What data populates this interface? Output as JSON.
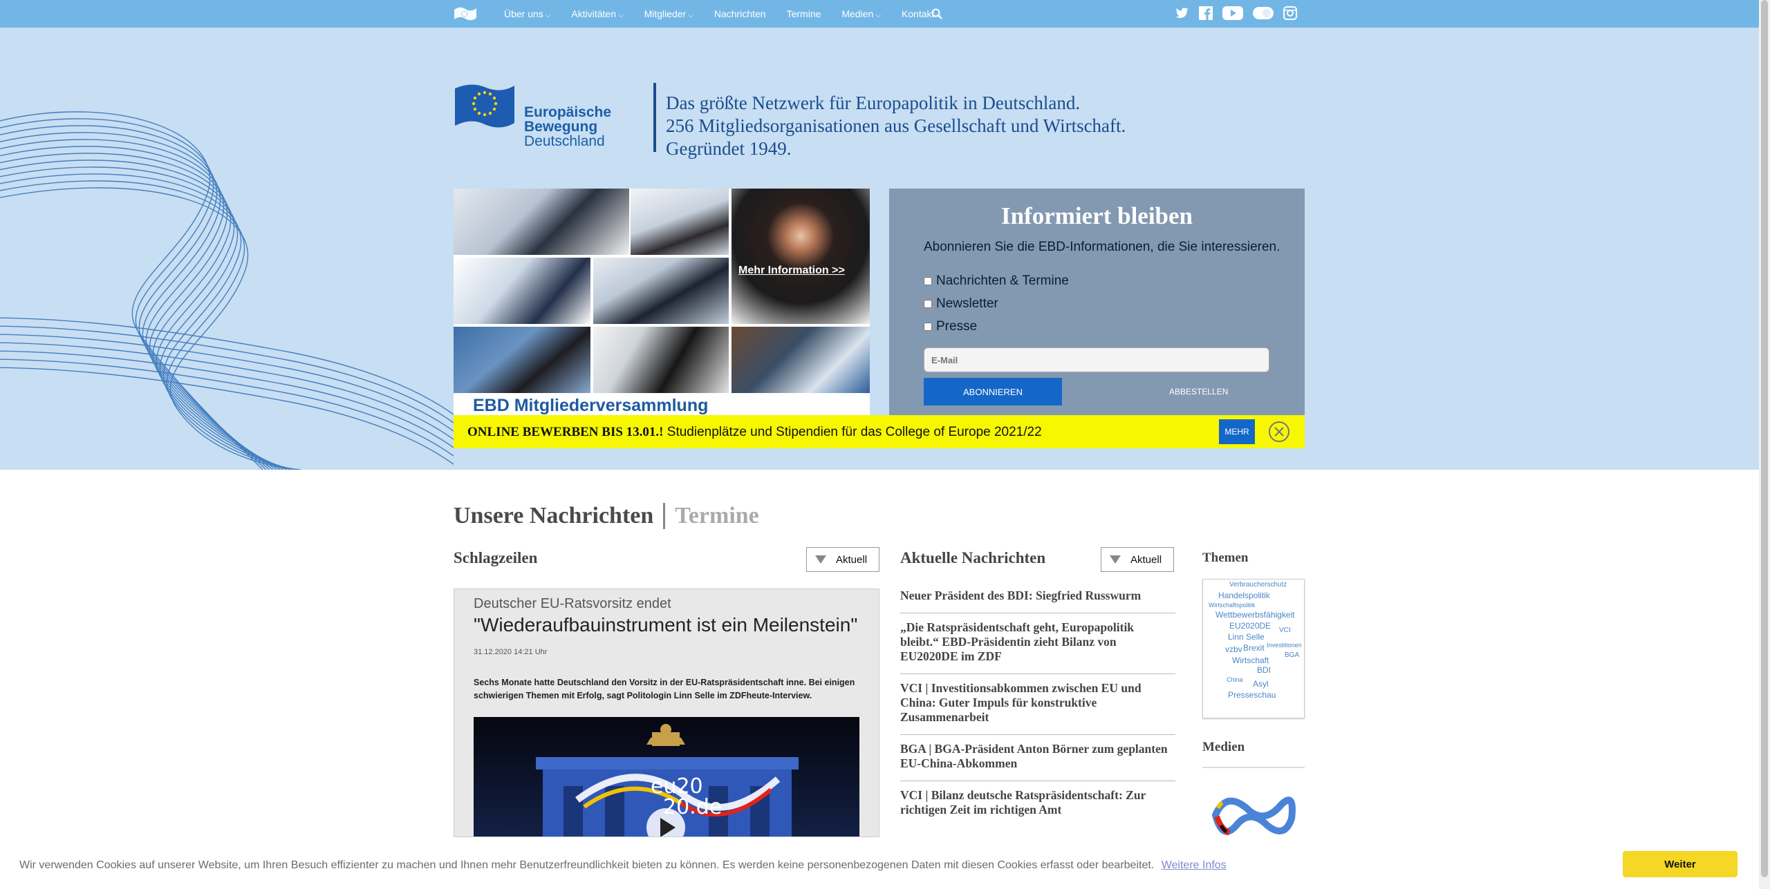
{
  "nav": {
    "items": [
      {
        "label": "Über uns",
        "dropdown": true
      },
      {
        "label": "Aktivitäten",
        "dropdown": true
      },
      {
        "label": "Mitglieder",
        "dropdown": true
      },
      {
        "label": "Nachrichten",
        "dropdown": false
      },
      {
        "label": "Termine",
        "dropdown": false
      },
      {
        "label": "Medien",
        "dropdown": true
      },
      {
        "label": "Kontakt",
        "dropdown": true
      }
    ],
    "social_icons": [
      "twitter-icon",
      "facebook-icon",
      "youtube-icon",
      "flickr-icon",
      "instagram-icon"
    ],
    "bar_color": "#72b6e6"
  },
  "brand": {
    "line1": "Europäische",
    "line2": "Bewegung",
    "line3": "Deutschland",
    "tagline_1": "Das größte Netzwerk für Europapolitik in Deutschland.",
    "tagline_2": "256 Mitgliedsorganisationen aus Gesellschaft und Wirtschaft.",
    "tagline_3": "Gegründet 1949."
  },
  "collage": {
    "caption": "EBD Mitgliederversammlung",
    "more_link": "Mehr Information",
    "more_arrows": ">>"
  },
  "subscribe": {
    "title": "Informiert bleiben",
    "intro": "Abonnieren Sie die EBD-Informationen, die Sie interessieren.",
    "options": [
      "Nachrichten & Termine",
      "Newsletter",
      "Presse"
    ],
    "email_placeholder": "E-Mail",
    "subscribe_button": "ABONNIEREN",
    "unsubscribe_button": "ABBESTELLEN"
  },
  "banner": {
    "bold": "ONLINE BEWERBEN BIS 13.01.!",
    "text": "Studienplätze und Stipendien für das College of Europe 2021/22",
    "button": "MEHR"
  },
  "tabs": {
    "active": "Unsere Nachrichten",
    "inactive": "Termine"
  },
  "headlines": {
    "title": "Schlagzeilen",
    "filter": "Aktuell",
    "article": {
      "kicker": "Deutscher EU-Ratsvorsitz endet",
      "title": "\"Wiederaufbauinstrument ist ein Meilenstein\"",
      "date": "31.12.2020 14:21 Uhr",
      "lead": "Sechs Monate hatte Deutschland den Vorsitz in der EU-Ratspräsidentschaft inne. Bei einigen schwierigen Themen mit Erfolg, sagt Politologin Linn Selle im ZDFheute-Interview.",
      "video_text_1": "eu20",
      "video_text_2": "20.de"
    }
  },
  "news": {
    "title": "Aktuelle Nachrichten",
    "filter": "Aktuell",
    "items": [
      "Neuer Präsident des BDI: Siegfried Russwurm",
      "„Die Ratspräsidentschaft geht, Europapolitik bleibt.“ EBD-Präsidentin zieht Bilanz von EU2020DE im ZDF",
      "VCI | Investitionsabkommen zwischen EU und China: Guter Impuls für konstruktive Zusammenarbeit",
      "BGA | BGA-Präsident Anton Börner zum geplanten EU-China-Abkommen",
      "VCI | Bilanz deutsche Ratspräsidentschaft: Zur richtigen Zeit im richtigen Amt"
    ]
  },
  "themen": {
    "title": "Themen",
    "tags": [
      "Verbraucherschutz",
      "Handelspolitik",
      "Wirtschaftspolitik",
      "Wettbewerbsfähigkeit",
      "EU2020DE",
      "VCI",
      "Linn Selle",
      "Investitionen",
      "vzbv",
      "Brexit",
      "BGA",
      "Wirtschaft",
      "BDI",
      "China",
      "Asyl",
      "Presseschau"
    ]
  },
  "medien": {
    "title": "Medien"
  },
  "cookie": {
    "message": "Wir verwenden Cookies auf unserer Website, um Ihren Besuch effizienter zu machen und Ihnen mehr Benutzerfreundlichkeit bieten zu können. Es werden keine personenbezogenen Daten mit diesen Cookies erfasst oder bearbeitet.",
    "link": "Weitere Infos",
    "button": "Weiter"
  },
  "colors": {
    "hero_bg": "#c8def2",
    "subscribe_bg": "#8399b1",
    "banner_bg": "#f7f700",
    "accent_blue": "#1467c8",
    "cookie_button": "#f5d726"
  }
}
